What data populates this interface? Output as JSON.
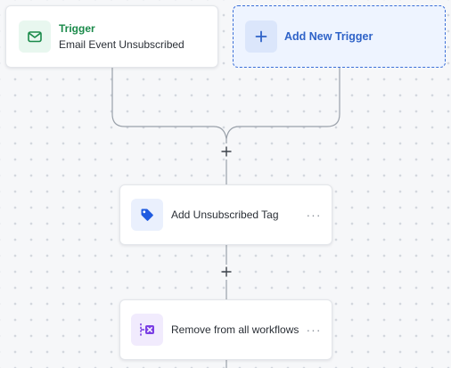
{
  "trigger": {
    "title": "Trigger",
    "event": "Email Event Unsubscribed"
  },
  "add_trigger": {
    "label": "Add New Trigger"
  },
  "actions": [
    {
      "label": "Add Unsubscribed Tag",
      "icon": "tag-icon"
    },
    {
      "label": "Remove from all workflows",
      "icon": "remove-workflow-icon"
    }
  ],
  "more_label": "···",
  "colors": {
    "trigger_green": "#1a8a4a",
    "accent_blue": "#2f63c8",
    "tag_blue": "#1f5be0",
    "remove_purple": "#7b3fe4"
  }
}
